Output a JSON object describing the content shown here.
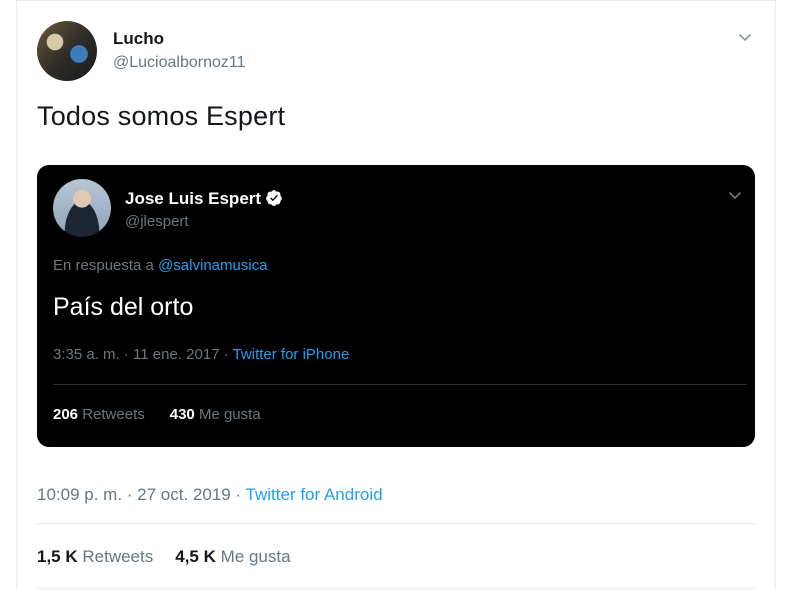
{
  "tweet": {
    "author": {
      "name": "Lucho",
      "handle": "@Lucioalbornoz11",
      "avatar_icon": "user-avatar"
    },
    "text": "Todos somos Espert",
    "timestamp": "10:09 p. m. · 27 oct. 2019",
    "separator": " · ",
    "source": "Twitter for Android",
    "stats": {
      "retweets_count": "1,5 K",
      "retweets_label": "Retweets",
      "likes_count": "4,5 K",
      "likes_label": "Me gusta"
    },
    "menu_icon": "chevron-down-icon"
  },
  "quoted_tweet": {
    "author": {
      "name": "Jose Luis Espert",
      "handle": "@jlespert",
      "verified": true,
      "avatar_icon": "user-avatar"
    },
    "reply_prefix": "En respuesta a ",
    "reply_to": "@salvinamusica",
    "text": "País del orto",
    "timestamp": "3:35 a. m. · 11 ene. 2017",
    "separator": " · ",
    "source": "Twitter for iPhone",
    "stats": {
      "retweets_count": "206",
      "retweets_label": "Retweets",
      "likes_count": "430",
      "likes_label": "Me gusta"
    },
    "menu_icon": "chevron-down-icon"
  },
  "colors": {
    "link": "#1da1f2",
    "secondary_text": "#657786",
    "primary_text": "#14171a",
    "dark_card": "#000000",
    "verified_badge": "#ffffff"
  }
}
